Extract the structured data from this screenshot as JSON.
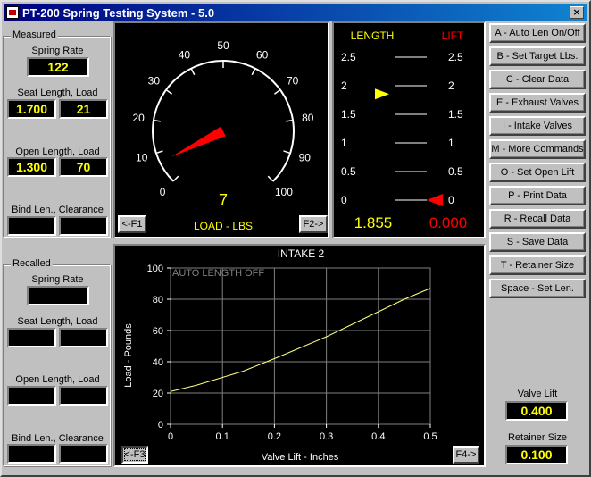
{
  "window": {
    "title": "PT-200 Spring Testing System - 5.0",
    "close_label": "×"
  },
  "measured": {
    "title": "Measured",
    "spring_rate_label": "Spring Rate",
    "spring_rate": "122",
    "seat_label": "Seat Length, Load",
    "seat_length": "1.700",
    "seat_load": "21",
    "open_label": "Open Length, Load",
    "open_length": "1.300",
    "open_load": "70",
    "bind_label": "Bind Len., Clearance",
    "bind_length": "",
    "bind_clearance": ""
  },
  "recalled": {
    "title": "Recalled",
    "spring_rate_label": "Spring Rate",
    "spring_rate": "",
    "seat_label": "Seat Length, Load",
    "seat_length": "",
    "seat_load": "",
    "open_label": "Open Length, Load",
    "open_length": "",
    "open_load": "",
    "bind_label": "Bind Len., Clearance",
    "bind_length": "",
    "bind_clearance": ""
  },
  "gauge": {
    "ticks": [
      "0",
      "10",
      "20",
      "30",
      "40",
      "50",
      "60",
      "70",
      "80",
      "90",
      "100"
    ],
    "value": 7,
    "value_text": "7",
    "max": 100,
    "label": "LOAD - LBS",
    "f1_label": "<-F1",
    "f2_label": "F2->",
    "needle_color": "#ff0000"
  },
  "length_lift": {
    "length_title": "LENGTH",
    "lift_title": "LIFT",
    "scale": [
      "2.5",
      "2",
      "1.5",
      "1",
      "0.5",
      "0"
    ],
    "length_value": 1.855,
    "length_text": "1.855",
    "lift_value": 0.0,
    "lift_text": "0.000",
    "length_color": "#ffff00",
    "lift_color": "#ff0000"
  },
  "commands": [
    "A - Auto Len On/Off",
    "B - Set Target Lbs.",
    "C - Clear Data",
    "E - Exhaust Valves",
    "I - Intake Valves",
    "M - More Commands",
    "O - Set Open Lift",
    "P - Print Data",
    "R - Recall Data",
    "S - Save Data",
    "T - Retainer Size",
    "Space - Set Len."
  ],
  "side_values": {
    "valve_lift_label": "Valve Lift",
    "valve_lift": "0.400",
    "retainer_label": "Retainer Size",
    "retainer": "0.100"
  },
  "chart_data": {
    "type": "line",
    "title": "INTAKE  2",
    "annotation": "AUTO LENGTH OFF",
    "xlabel": "Valve Lift - Inches",
    "ylabel": "Load - Pounds",
    "xlim": [
      0,
      0.5
    ],
    "ylim": [
      0,
      100
    ],
    "x_ticks": [
      "0",
      "0.1",
      "0.2",
      "0.3",
      "0.4",
      "0.5"
    ],
    "y_ticks": [
      "0",
      "20",
      "40",
      "60",
      "80",
      "100"
    ],
    "grid": true,
    "series": [
      {
        "color": "#ffff80",
        "x": [
          0,
          0.05,
          0.1,
          0.14,
          0.2,
          0.25,
          0.3,
          0.35,
          0.4,
          0.45,
          0.5
        ],
        "y": [
          21,
          25,
          30,
          34,
          42,
          49,
          56,
          64,
          72,
          80,
          87
        ]
      }
    ],
    "f3_label": "<-F3",
    "f4_label": "F4->"
  }
}
